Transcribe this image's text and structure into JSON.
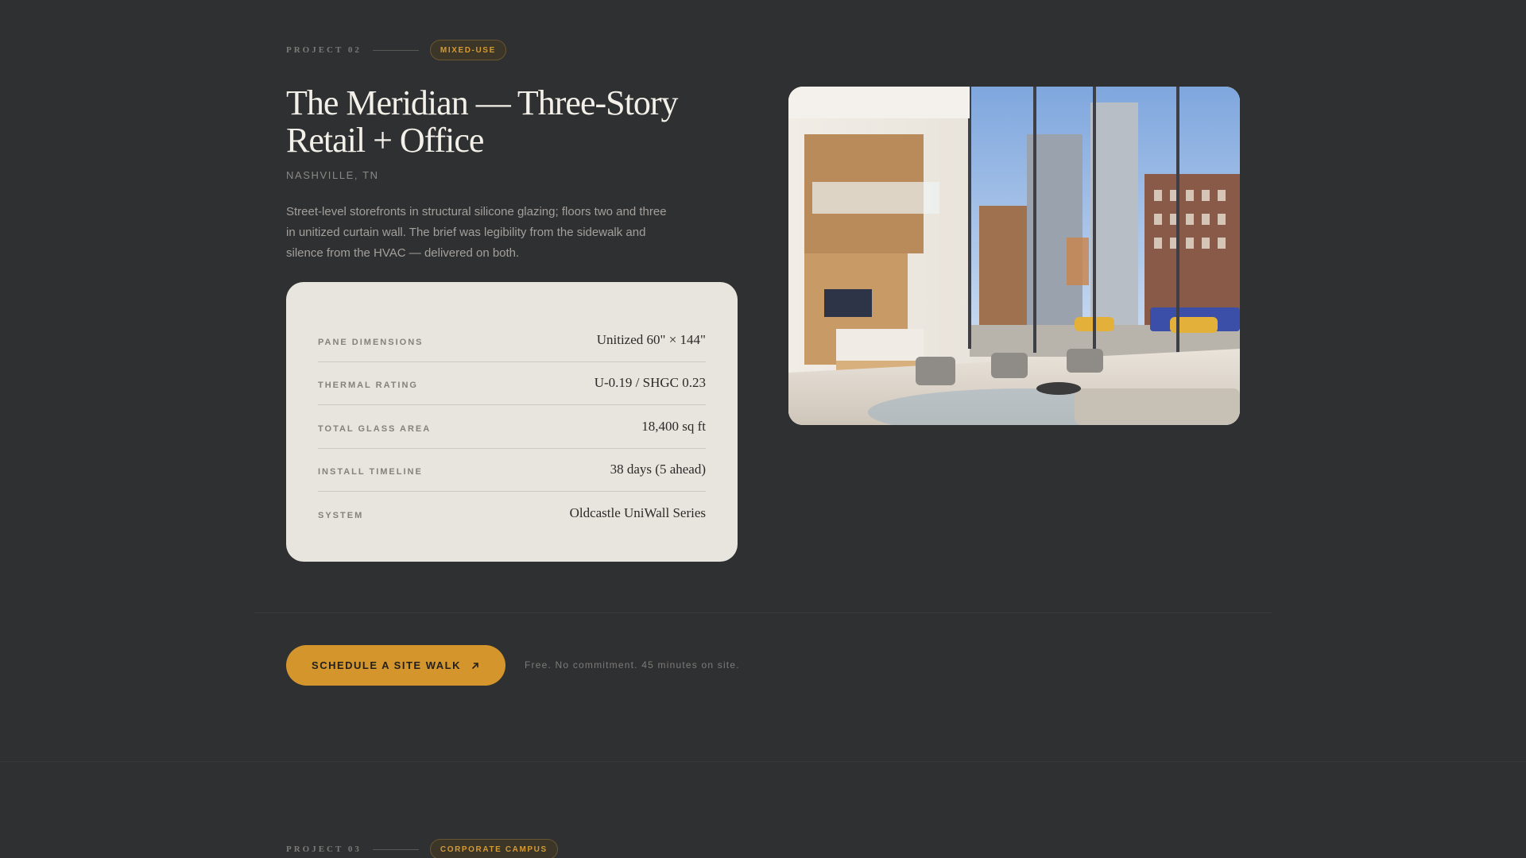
{
  "project2": {
    "number_label": "PROJECT 02",
    "badge": "MIXED-USE",
    "title": "The Meridian — Three-Story Retail + Office",
    "location": "NASHVILLE, TN",
    "description": "Street-level storefronts in structural silicone glazing; floors two and three in unitized curtain wall. The brief was legibility from the sidewalk and silence from the HVAC — delivered on both.",
    "specs": [
      {
        "label": "PANE DIMENSIONS",
        "value": "Unitized 60\" × 144\""
      },
      {
        "label": "THERMAL RATING",
        "value": "U-0.19 / SHGC 0.23"
      },
      {
        "label": "TOTAL GLASS AREA",
        "value": "18,400 sq ft"
      },
      {
        "label": "INSTALL TIMELINE",
        "value": "38 days (5 ahead)"
      },
      {
        "label": "SYSTEM",
        "value": "Oldcastle UniWall Series"
      }
    ],
    "cta_label": "SCHEDULE A SITE WALK",
    "cta_icon": "arrow-up-right-icon",
    "cta_note": "Free. No commitment. 45 minutes on site."
  },
  "project3": {
    "number_label": "PROJECT 03",
    "badge": "CORPORATE CAMPUS"
  },
  "colors": {
    "background": "#2f3032",
    "accent": "#d4962c",
    "card": "#e8e4de"
  }
}
